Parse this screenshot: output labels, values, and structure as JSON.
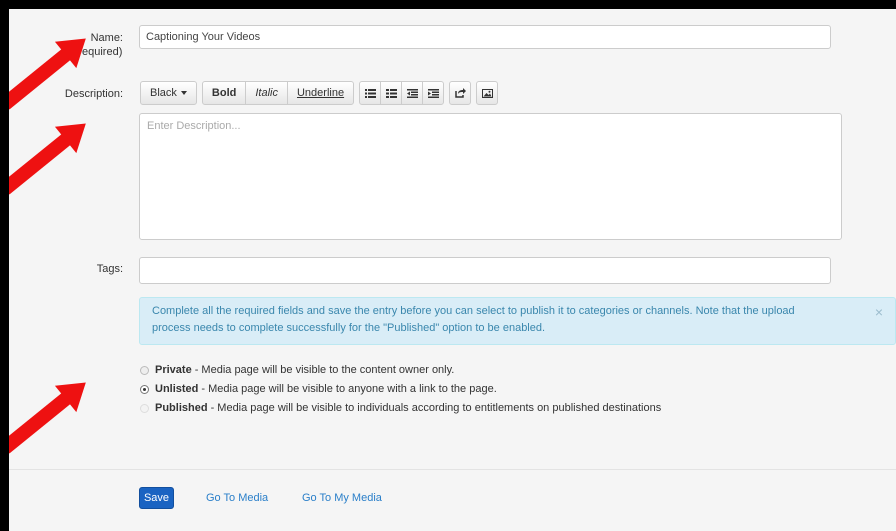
{
  "form": {
    "name_label": "Name:",
    "required_label": "equired)",
    "name_value": "Captioning Your Videos",
    "description_label": "Description:",
    "description_placeholder": "Enter Description...",
    "tags_label": "Tags:",
    "tags_value": ""
  },
  "toolbar": {
    "color_label": "Black",
    "bold_label": "Bold",
    "italic_label": "Italic",
    "underline_label": "Underline",
    "icons": [
      "unordered-list-icon",
      "ordered-list-icon",
      "outdent-icon",
      "indent-icon",
      "link-icon",
      "image-icon"
    ]
  },
  "alert": {
    "text": "Complete all the required fields and save the entry before you can select to publish it to categories or channels. Note that the upload process needs to complete successfully for the \"Published\" option to be enabled.",
    "close": "×"
  },
  "visibility": [
    {
      "title": "Private",
      "desc": "- Media page will be visible to the content owner only.",
      "selected": false,
      "enabled": true
    },
    {
      "title": "Unlisted",
      "desc": "- Media page will be visible to anyone with a link to the page.",
      "selected": true,
      "enabled": true
    },
    {
      "title": "Published",
      "desc": "- Media page will be visible to individuals according to entitlements on published destinations",
      "selected": false,
      "enabled": false
    }
  ],
  "footer": {
    "save_label": "Save",
    "go_to_media": "Go To Media",
    "go_to_my_media": "Go To My Media"
  },
  "colors": {
    "primary": "#1a63c2",
    "link": "#2a7fc9",
    "alert_bg": "#d9edf7",
    "annotation_arrow": "#ee1111"
  }
}
